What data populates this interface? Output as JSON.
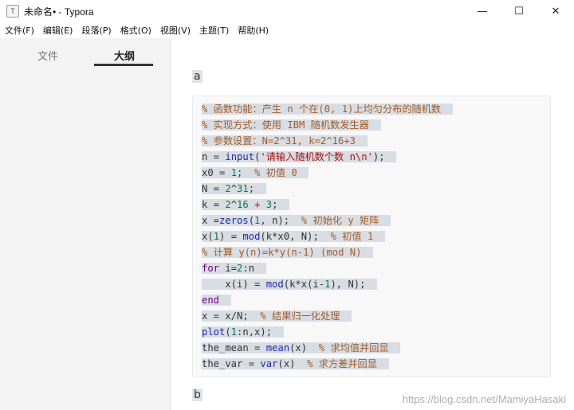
{
  "window": {
    "icon_glyph": "T",
    "title": "未命名• - Typora",
    "minimize": "—",
    "maximize": "☐",
    "close": "✕"
  },
  "menu": [
    "文件(F)",
    "编辑(E)",
    "段落(P)",
    "格式(O)",
    "视图(V)",
    "主题(T)",
    "帮助(H)"
  ],
  "sidebar": {
    "tabs": [
      {
        "label": "文件",
        "active": false
      },
      {
        "label": "大纲",
        "active": true
      }
    ]
  },
  "editor": {
    "para_a": "a",
    "para_b": "b",
    "code_lines": [
      "% 函数功能：产生 n 个在(0, 1)上均匀分布的随机数",
      "% 实现方式：使用 IBM 随机数发生器",
      "% 参数设置：N=2^31, k=2^16+3",
      "n = input('请输入随机数个数 n\\n');",
      "x0 = 1;  % 初值 0",
      "N = 2^31;",
      "k = 2^16 + 3;",
      "x =zeros(1, n);  % 初始化 y 矩阵",
      "x(1) = mod(k*x0, N);  % 初值 1",
      "% 计算 y(n)=k*y(n-1) (mod N)",
      "for i=2:n",
      "    x(i) = mod(k*x(i-1), N);",
      "end",
      "x = x/N;  % 结果归一化处理",
      "plot(1:n,x);",
      "the_mean = mean(x)  % 求均值并回显",
      "the_var = var(x)  % 求方差并回显"
    ]
  },
  "watermark": "https://blog.csdn.net/MamiyaHasaki",
  "colors": {
    "comment": "#a15b2b",
    "keyword": "#770088",
    "function": "#1d2aa8",
    "number": "#11745a",
    "string": "#aa1111",
    "sidebar_bg": "#f3f3f3",
    "code_bg": "#f8f8f8",
    "selection": "#d8dde3"
  }
}
